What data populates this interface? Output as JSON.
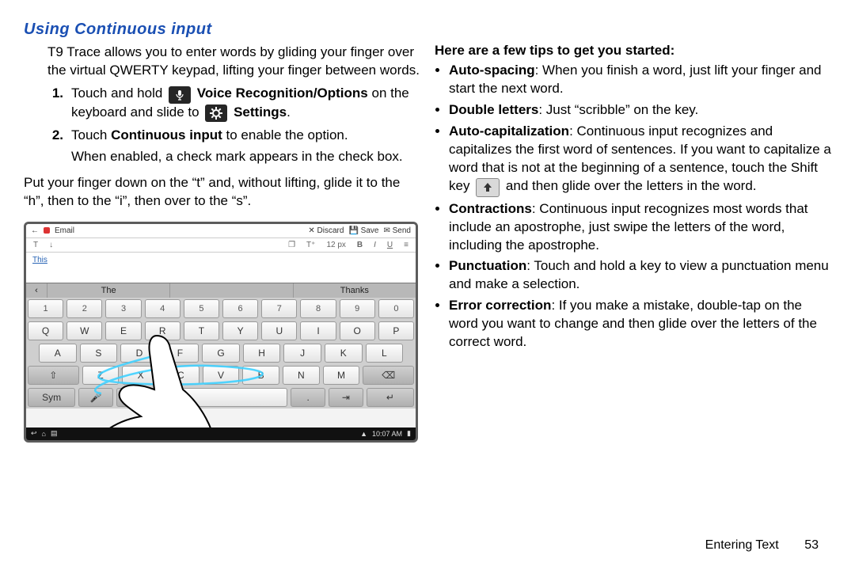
{
  "heading": "Using Continuous input",
  "intro": "T9 Trace allows you to enter words by gliding your finger over the virtual QWERTY keypad, lifting your finger between words.",
  "step1": {
    "num": "1.",
    "pre": "Touch and hold ",
    "label1": "Voice Recognition/Options",
    "mid": " on the keyboard and slide to ",
    "label2": "Settings",
    "post": "."
  },
  "step2": {
    "num": "2.",
    "pre": "Touch ",
    "label": "Continuous input",
    "post": " to enable the option."
  },
  "step2b": "When enabled, a check mark appears in the check box.",
  "para2": "Put your finger down on the “t” and, without lifting, glide it to the “h”, then to the “i”, then over to the “s”.",
  "tips_head": "Here are a few tips to get you started:",
  "tips": {
    "t1": {
      "b": "Auto-spacing",
      "t": ": When you finish a word, just lift your finger and start the next word."
    },
    "t2": {
      "b": "Double letters",
      "t": ": Just “scribble” on the key."
    },
    "t3a": {
      "b": "Auto-capitalization",
      "pre": ": Continuous input recognizes and capitalizes the first word of sentences. If you want to capitalize a word that is not at the beginning of a sentence, touch the Shift key ",
      "post": " and then glide over the letters in the word."
    },
    "t4": {
      "b": "Contractions",
      "t": ": Continuous input recognizes most words that include an apostrophe, just swipe the letters of the word, including the apostrophe."
    },
    "t5": {
      "b": "Punctuation",
      "t": ": Touch and hold a key to view a punctuation menu and make a selection."
    },
    "t6": {
      "b": "Error correction",
      "t": ": If you make a mistake, double-tap on the word you want to change and then glide over the letters of the correct word."
    }
  },
  "footer": {
    "chapter": "Entering Text",
    "page": "53"
  },
  "mock": {
    "back": "←",
    "email": "Email",
    "discard": "✕ Discard",
    "save": "💾 Save",
    "send": "✉ Send",
    "tool_T": "T",
    "tool_arrow": "↓",
    "tool_img": "❐",
    "tool_Ts": "T⁺",
    "tool_sz": "12 px",
    "tool_B": "B",
    "tool_I": "I",
    "tool_U": "U",
    "tool_list": "≡",
    "typed": "This",
    "sugg_arrow": "‹",
    "sugg1": "The",
    "sugg2": "",
    "sugg3": "Thanks",
    "row_num": [
      "1",
      "2",
      "3",
      "4",
      "5",
      "6",
      "7",
      "8",
      "9",
      "0"
    ],
    "row_q": [
      "Q",
      "W",
      "E",
      "R",
      "T",
      "Y",
      "U",
      "I",
      "O",
      "P"
    ],
    "row_a": [
      "A",
      "S",
      "D",
      "F",
      "G",
      "H",
      "J",
      "K",
      "L"
    ],
    "row_z": [
      "Z",
      "X",
      "C",
      "V",
      "B",
      "N",
      "M"
    ],
    "shift": "⇧",
    "bksp": "⌫",
    "sym": "Sym",
    "mic": "🎤",
    "comma": ",",
    "space": "",
    "period": ".",
    "tab": "⇥",
    "enter": "↵",
    "status_home": "⌂",
    "status_back": "↩",
    "status_apps": "▤",
    "status_sig": "▲",
    "status_time": "10:07 AM",
    "status_batt": "▮"
  }
}
